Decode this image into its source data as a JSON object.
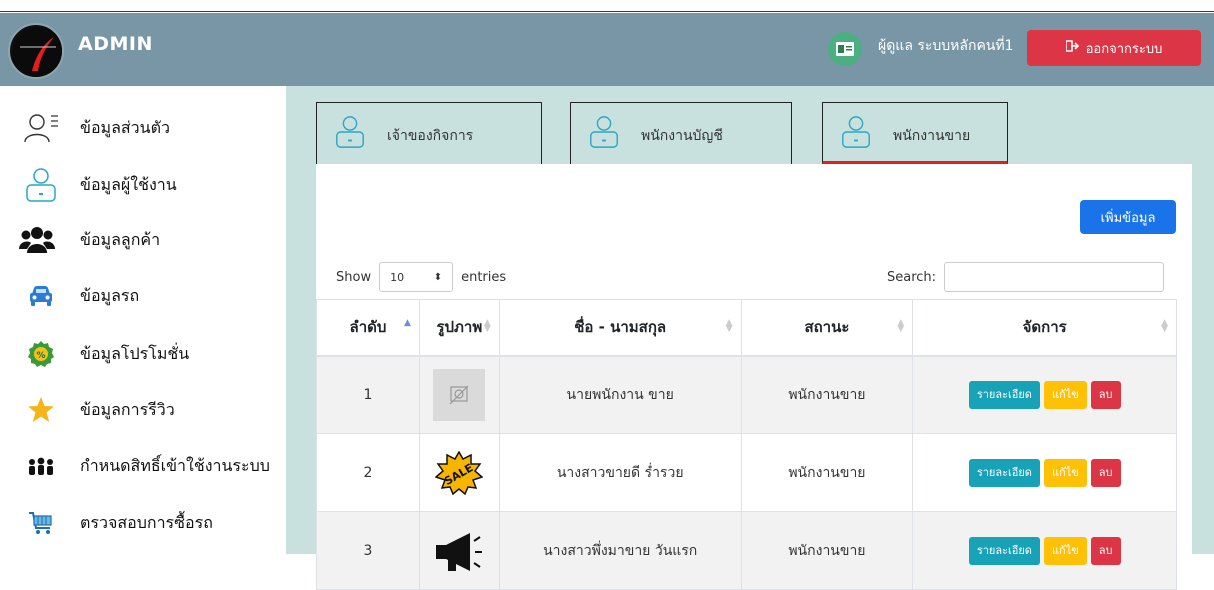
{
  "header": {
    "brand": "ADMIN",
    "user_name": "ผู้ดูแล ระบบหลักคนที่1",
    "logout_label": "ออกจากระบบ"
  },
  "sidebar": {
    "items": [
      {
        "label": "ข้อมูลส่วนตัว",
        "icon": "profile-outline-icon"
      },
      {
        "label": "ข้อมูลผู้ใช้งาน",
        "icon": "user-laptop-icon"
      },
      {
        "label": "ข้อมูลลูกค้า",
        "icon": "users-group-icon"
      },
      {
        "label": "ข้อมูลรถ",
        "icon": "car-icon"
      },
      {
        "label": "ข้อมูลโปรโมชั่น",
        "icon": "discount-badge-icon"
      },
      {
        "label": "ข้อมูลการรีวิว",
        "icon": "star-icon"
      },
      {
        "label": "กำหนดสิทธิ์เข้าใช้งานระบบ",
        "icon": "people-permissions-icon"
      },
      {
        "label": "ตรวจสอบการซื้อรถ",
        "icon": "shopping-cart-icon"
      }
    ]
  },
  "tabs": [
    {
      "label": "เจ้าของกิจการ",
      "active": false
    },
    {
      "label": "พนักงานบัญชี",
      "active": false
    },
    {
      "label": "พนักงานขาย",
      "active": true
    }
  ],
  "panel": {
    "add_label": "เพิ่มข้อมูล",
    "show_label": "Show",
    "entries_value": "10",
    "entries_label": "entries",
    "search_label": "Search:",
    "search_value": ""
  },
  "table": {
    "headers": [
      "ลำดับ",
      "รูปภาพ",
      "ชื่อ - นามสกุล",
      "สถานะ",
      "จัดการ"
    ],
    "rows": [
      {
        "no": "1",
        "image": "no-image-placeholder-icon",
        "name": "นายพนักงาน ขาย",
        "status": "พนักงานขาย"
      },
      {
        "no": "2",
        "image": "sale-badge-icon",
        "name": "นางสาวขายดี ร่ำรวย",
        "status": "พนักงานขาย"
      },
      {
        "no": "3",
        "image": "megaphone-icon",
        "name": "นางสาวพึ่งมาขาย วันแรก",
        "status": "พนักงานขาย"
      }
    ],
    "action_labels": {
      "detail": "รายละเอียด",
      "edit": "แก้ไข",
      "delete": "ลบ"
    }
  },
  "colors": {
    "header": "#7896a5",
    "content_bg": "#c8e1de",
    "danger": "#dc3545",
    "primary": "#1a73e8",
    "info": "#17a2b8",
    "warning": "#ffc107",
    "active_tab_border": "#e02020"
  }
}
